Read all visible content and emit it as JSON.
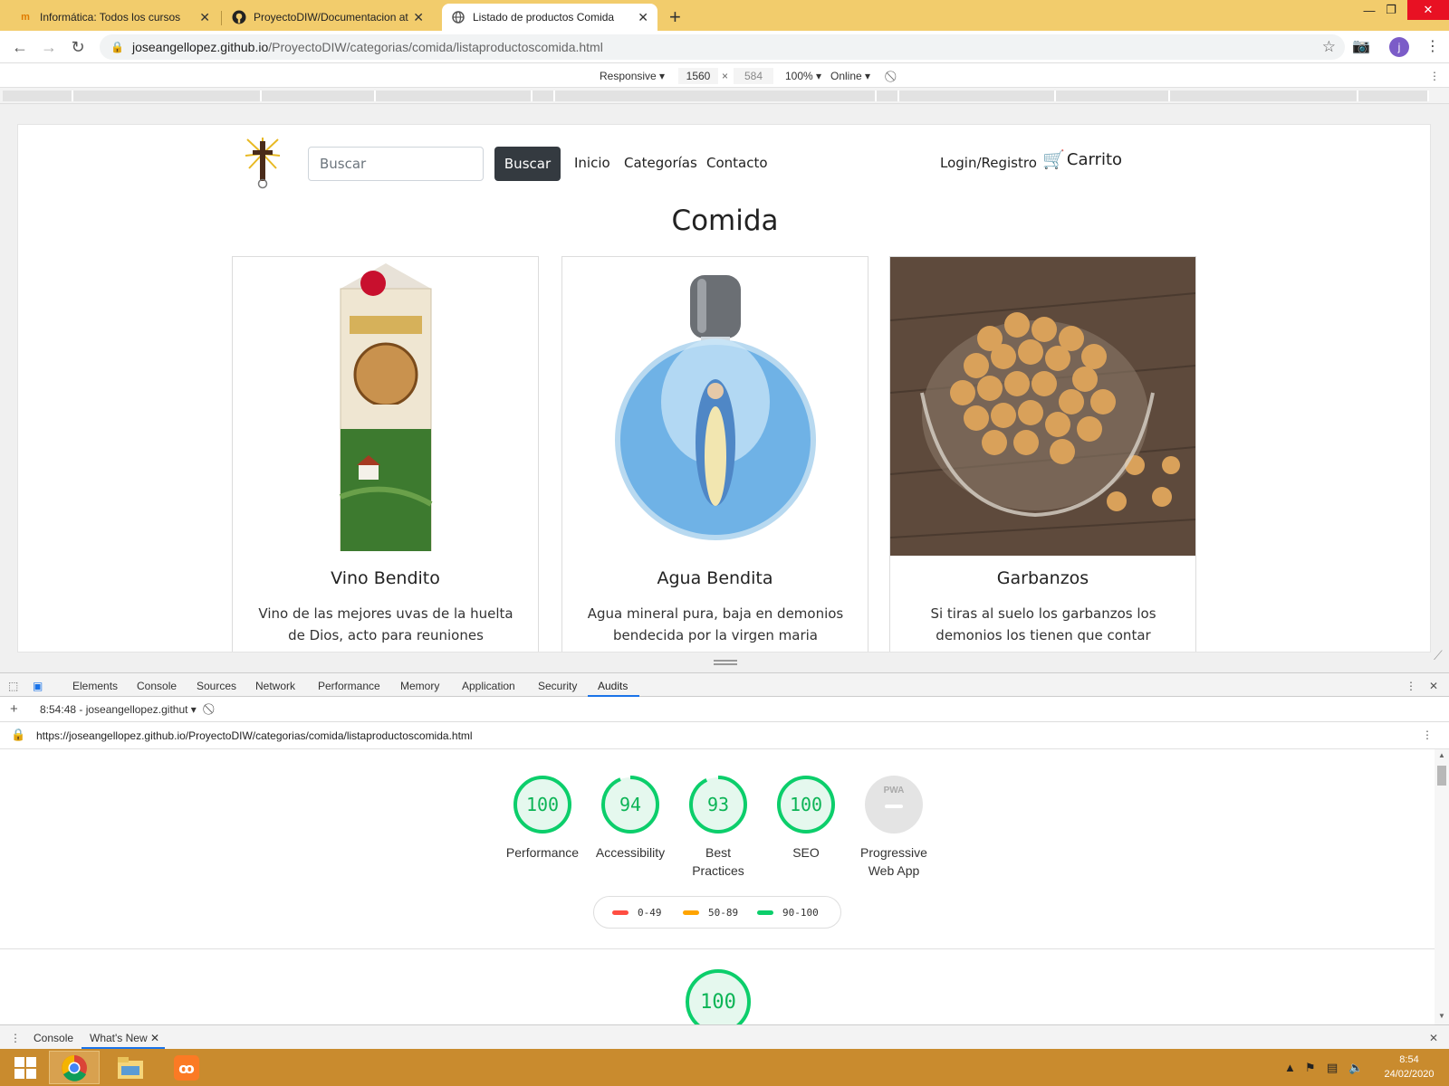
{
  "browser": {
    "tabs": [
      {
        "title": "Informática: Todos los cursos",
        "favicon": "moodle-icon"
      },
      {
        "title": "ProyectoDIW/Documentacion at",
        "favicon": "github-icon"
      },
      {
        "title": "Listado de productos Comida",
        "favicon": "globe-icon"
      }
    ],
    "url_host": "joseangellopez.github.io",
    "url_path": "/ProyectoDIW/categorias/comida/listaproductoscomida.html",
    "profile_initial": "j"
  },
  "device_toolbar": {
    "mode": "Responsive",
    "width": "1560",
    "height": "584",
    "zoom": "100%",
    "network": "Online"
  },
  "site": {
    "search_placeholder": "Buscar",
    "search_button": "Buscar",
    "nav": [
      "Inicio",
      "Categorías",
      "Contacto"
    ],
    "login": "Login/Registro",
    "cart": "Carrito",
    "heading": "Comida",
    "products": [
      {
        "name": "Vino Bendito",
        "description": "Vino de las mejores uvas de la huelta de Dios, acto para reuniones"
      },
      {
        "name": "Agua Bendita",
        "description": "Agua mineral pura, baja en demonios bendecida por la virgen maria"
      },
      {
        "name": "Garbanzos",
        "description": "Si tiras al suelo los garbanzos los demonios los tienen que contar"
      }
    ]
  },
  "devtools": {
    "tabs": [
      "Elements",
      "Console",
      "Sources",
      "Network",
      "Performance",
      "Memory",
      "Application",
      "Security",
      "Audits"
    ],
    "active_tab": "Audits",
    "report_selector": "8:54:48 - joseangellopez.githut",
    "report_url": "https://joseangellopez.github.io/ProyectoDIW/categorias/comida/listaproductoscomida.html",
    "scores": [
      {
        "label": "Performance",
        "score": 100
      },
      {
        "label": "Accessibility",
        "score": 94
      },
      {
        "label": "Best Practices",
        "score": 93
      },
      {
        "label": "SEO",
        "score": 100
      },
      {
        "label": "Progressive Web App",
        "score": null,
        "badge": "PWA"
      }
    ],
    "legend": [
      "0-49",
      "50-89",
      "90-100"
    ],
    "legend_colors": [
      "#ff4e42",
      "#ffa400",
      "#0cce6b"
    ],
    "section_score": "100",
    "drawer_tabs": [
      "Console",
      "What's New"
    ]
  },
  "taskbar": {
    "time": "8:54",
    "date": "24/02/2020"
  },
  "colors": {
    "tabstrip": "#f2cc6c",
    "taskbar": "#c98b2e",
    "pass_green": "#0cce6b",
    "button_dark": "#343a40"
  }
}
